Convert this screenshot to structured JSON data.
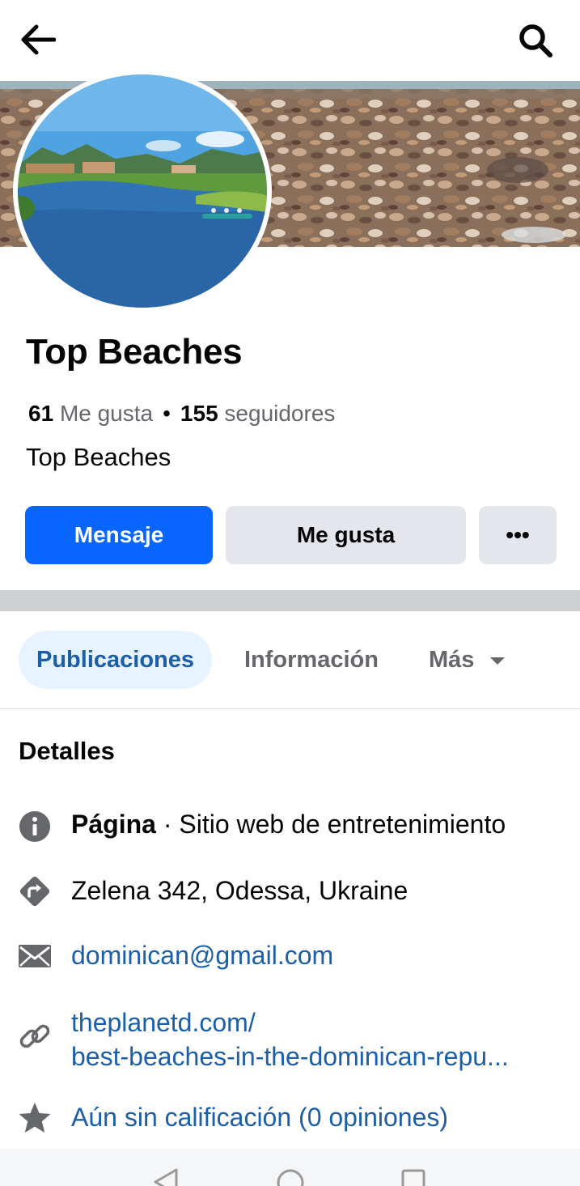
{
  "header": {
    "back_icon": "arrow-left-icon",
    "search_icon": "search-icon"
  },
  "page": {
    "title": "Top Beaches",
    "likes_count": "61",
    "likes_label": "Me gusta",
    "followers_count": "155",
    "followers_label": "seguidores",
    "category": "Top Beaches"
  },
  "actions": {
    "message_label": "Mensaje",
    "like_label": "Me gusta",
    "more_label": "•••"
  },
  "tabs": [
    {
      "label": "Publicaciones",
      "active": true
    },
    {
      "label": "Información",
      "active": false
    },
    {
      "label": "Más",
      "active": false
    }
  ],
  "details": {
    "title": "Detalles",
    "page_type_bold": "Página",
    "page_type_rest": " · Sitio web de entretenimiento",
    "address": "Zelena 342, Odessa, Ukraine",
    "email": "dominican@gmail.com",
    "website_line1": "theplanetd.com/",
    "website_line2": "best-beaches-in-the-dominican-repu...",
    "rating": "Aún sin calificación (0 opiniones)"
  },
  "colors": {
    "accent": "#0866ff",
    "link": "#1b5fa8",
    "button_gray": "#e4e6eb",
    "tab_active_bg": "#e7f3ff"
  }
}
